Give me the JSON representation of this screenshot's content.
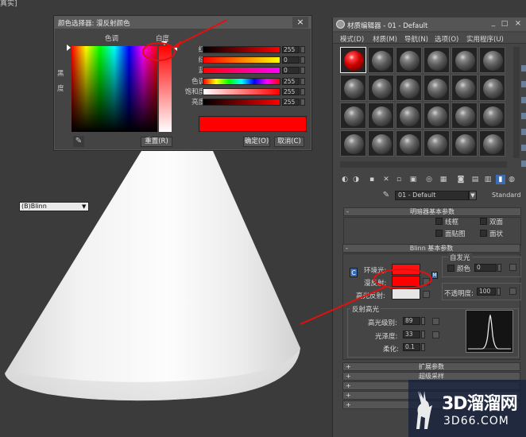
{
  "viewport": {
    "label": "真实]"
  },
  "color_picker": {
    "title": "颜色选择器: 漫反射颜色",
    "close_label": "×",
    "hue_label": "色调",
    "whiteness_label": "白度",
    "blackness_label": "黑度",
    "channels": [
      {
        "label": "红:",
        "value": "255"
      },
      {
        "label": "绿:",
        "value": "0"
      },
      {
        "label": "蓝:",
        "value": "0"
      },
      {
        "label": "色调:",
        "value": "255"
      },
      {
        "label": "饱和度:",
        "value": "255"
      },
      {
        "label": "亮度:",
        "value": "255"
      }
    ],
    "reset_label": "重置(R)",
    "ok_label": "确定(O)",
    "cancel_label": "取消(C)",
    "current_color": "#ff0000"
  },
  "material_editor": {
    "title": "材质编辑器 - 01 - Default",
    "min_label": "_",
    "max_label": "□",
    "close_label": "×",
    "menu": [
      "模式(D)",
      "材质(M)",
      "导航(N)",
      "选项(O)",
      "实用程序(U)"
    ],
    "material_name": "01 - Default",
    "material_type": "Standard",
    "shader_basic_params": {
      "title": "明暗器基本参数",
      "shader": "(B)Blinn",
      "options": [
        "线框",
        "双面",
        "面贴图",
        "面状"
      ]
    },
    "blinn_basic_params": {
      "title": "Blinn 基本参数",
      "self_illum_label": "自发光",
      "color_label": "颜色",
      "color_value": "0",
      "ambient_label": "环境光:",
      "diffuse_label": "漫反射:",
      "specular_label": "高光反射:",
      "opacity_label": "不透明度:",
      "opacity_value": "100",
      "ambient_color": "#ff1010",
      "diffuse_color": "#ff0000",
      "specular_color": "#e6e6e6",
      "lock_label": "C",
      "map_lock_label": "M"
    },
    "specular_highlights": {
      "title": "反射高光",
      "level_label": "高光级别:",
      "level_value": "89",
      "gloss_label": "光泽度:",
      "gloss_value": "33",
      "soften_label": "柔化:",
      "soften_value": "0.1"
    },
    "extended_params_label": "扩展参数",
    "supersampling_label": "超级采样"
  },
  "watermark": {
    "line1": "3D溜溜网",
    "line2": "3D66.COM"
  },
  "colors": {
    "annotation_red": "#e31010",
    "ui_bg": "#444444"
  }
}
